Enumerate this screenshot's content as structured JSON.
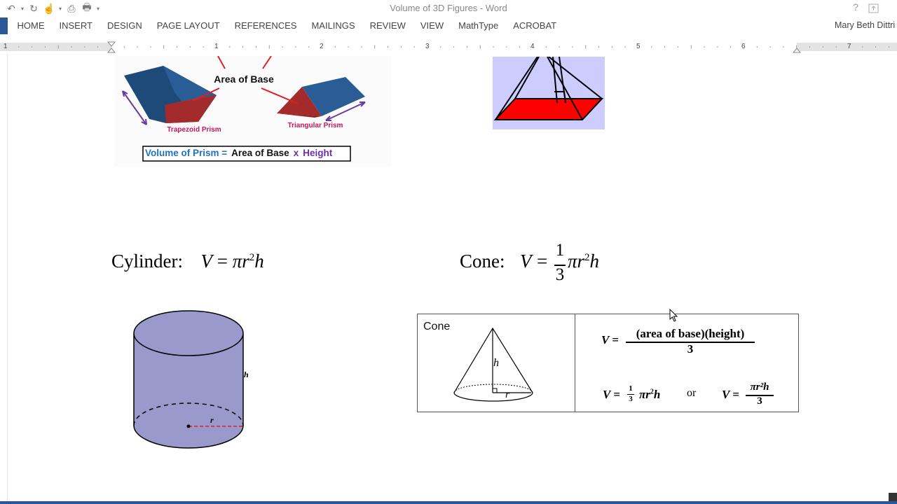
{
  "window": {
    "title": "Volume of 3D Figures - Word"
  },
  "user": {
    "name": "Mary Beth Dittri"
  },
  "ribbon": {
    "tabs": [
      "HOME",
      "INSERT",
      "DESIGN",
      "PAGE LAYOUT",
      "REFERENCES",
      "MAILINGS",
      "REVIEW",
      "VIEW",
      "MathType",
      "ACROBAT"
    ]
  },
  "ruler": {
    "labels": [
      "1",
      "1",
      "2",
      "3",
      "4",
      "5",
      "6",
      "7"
    ]
  },
  "prism_figure": {
    "area_of_base": "Area of Base",
    "trapezoid_label": "Trapezoid Prism",
    "triangular_label": "Triangular Prism",
    "formula_part1": "Volume of Prism =",
    "formula_part2": "Area of Base",
    "formula_x": "x",
    "formula_part3": "Height"
  },
  "cylinder": {
    "label": "Cylinder:",
    "V": "V",
    "eq": "=",
    "pi": "π",
    "r": "r",
    "exp": "2",
    "h": "h",
    "fig_h": "h",
    "fig_r": "r"
  },
  "cone": {
    "label": "Cone:",
    "V": "V",
    "eq": "=",
    "num": "1",
    "den": "3",
    "pi": "π",
    "r": "r",
    "exp": "2",
    "h": "h"
  },
  "cone_table": {
    "title": "Cone",
    "fig_h": "h",
    "fig_r": "r",
    "f1_lhs": "V =",
    "f1_num": "(area of base)(height)",
    "f1_den": "3",
    "f2_lhs": "V =",
    "f2_num": "1",
    "f2_den": "3",
    "f2_rest": "πr",
    "f2_exp": "2",
    "f2_h": "h",
    "or": "or",
    "f3_lhs": "V =",
    "f3_num": "πr²h",
    "f3_den": "3"
  },
  "colors": {
    "accent": "#2b579a",
    "prism_blue": "#1e4a7a",
    "prism_red": "#b22222",
    "cylinder_fill": "#9999cc",
    "pyramid_bg": "#ccccff",
    "pyramid_base": "#ff0000"
  }
}
